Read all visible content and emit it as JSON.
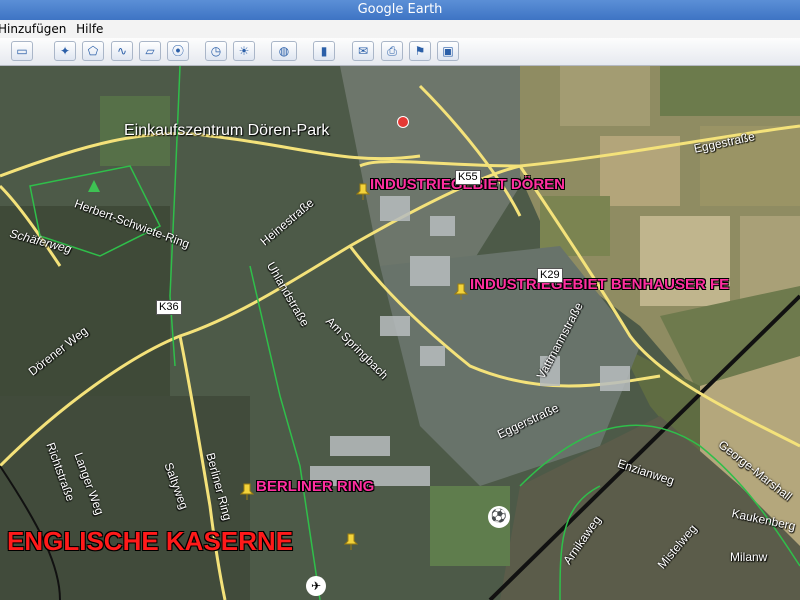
{
  "window": {
    "title": "Google Earth"
  },
  "menu": {
    "items": [
      "Hinzufügen",
      "Hilfe"
    ]
  },
  "toolbar": {
    "buttons": [
      "sidebar-icon",
      "placemark-icon",
      "polygon-icon",
      "path-icon",
      "overlay-icon",
      "record-tour-icon",
      "historical-imagery-icon",
      "sunlight-icon",
      "planets-icon",
      "ruler-icon",
      "email-icon",
      "print-icon",
      "view-in-maps-icon",
      "save-image-icon"
    ]
  },
  "map": {
    "places": {
      "einkaufszentrum": "Einkaufszentrum Dören-Park",
      "industrie_doeren": "INDUSTRIEGEBIET DÖREN",
      "industrie_benhauser": "INDUSTRIEGEBIET BENHAUSER FE",
      "berliner_ring": "BERLINER RING",
      "englische_kaserne": "ENGLISCHE KASERNE"
    },
    "streets": {
      "eggestrasse": "Eggestraße",
      "herbert": "Herbert-Schwiete-Ring",
      "schaeferweg": "Schäferweg",
      "heinestrasse": "Heinestraße",
      "uhlandstrasse": "Uhlandstraße",
      "am_springbach": "Am Springbach",
      "doerener_weg": "Dörener Weg",
      "richtstrasse": "Richtstraße",
      "langer_weg": "Langer Weg",
      "saltyweg": "Saltyweg",
      "berliner_ring_st": "Berliner Ring",
      "vattmannstrasse": "Vattmannstraße",
      "eggerstrasse": "Eggerstraße",
      "enzianweg": "Enzianweg",
      "arnikaweg": "Arnikaweg",
      "kaukenberg": "Kaukenberg",
      "mistelweg": "Mistelweg",
      "milanweg": "Milanw",
      "george_marshall": "George-Marshall"
    },
    "shields": {
      "k36": "K36",
      "k29": "K29",
      "k55": "K55"
    }
  },
  "colors": {
    "pink_label": "#ff2fa0",
    "red_label": "#ff1a1a",
    "road_yellow": "#f4e27a",
    "boundary_green": "#2fbf4a"
  }
}
